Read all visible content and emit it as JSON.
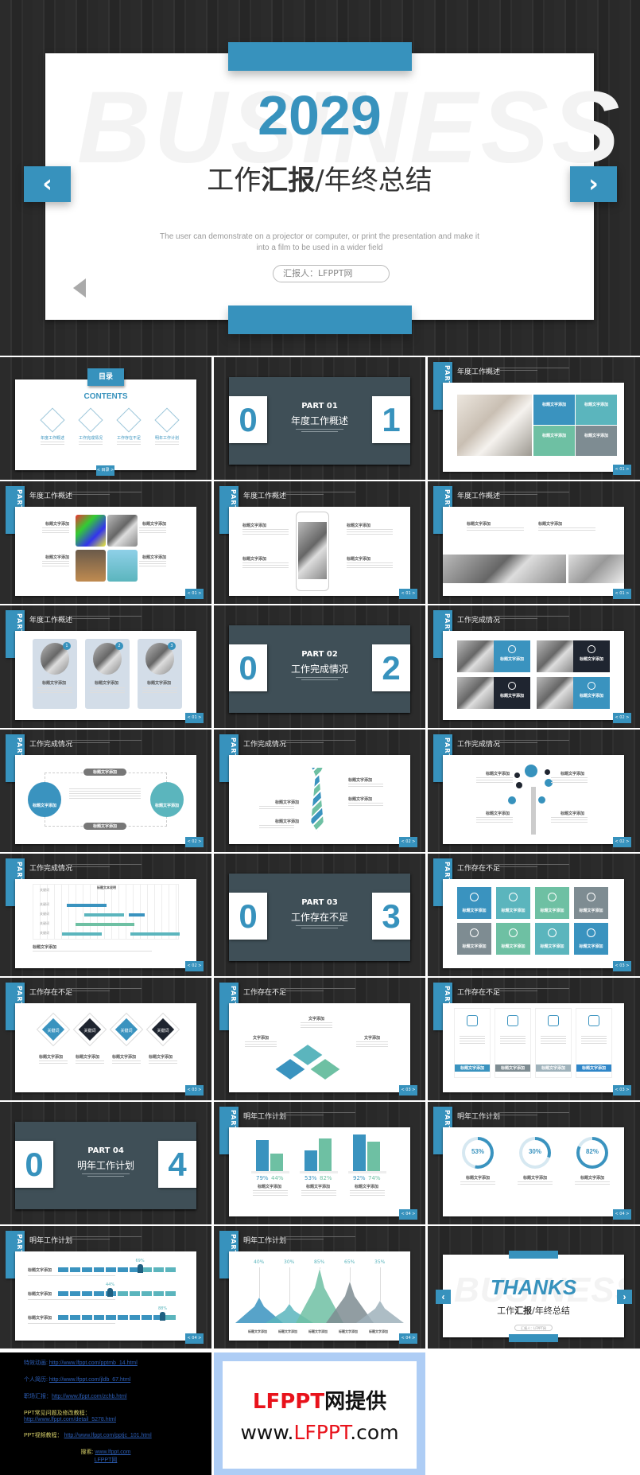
{
  "hero": {
    "watermark": "BUSINESS",
    "year": "2029",
    "title_parts": [
      "工作",
      "汇报",
      "/年终总结"
    ],
    "subtitle_line1": "The user can demonstrate on a projector or computer, or print the presentation and make it",
    "subtitle_line2": "into a film to be used in a wider field",
    "presenter": "汇报人：LFPPT网",
    "prev_icon": "‹",
    "next_icon": "›",
    "accent": "#3792bd"
  },
  "slides": [
    {
      "type": "contents",
      "tab": "目录",
      "heading": "CONTENTS",
      "items": [
        "年度工作概述",
        "工作完成情况",
        "工作存在不足",
        "明年工作计划"
      ],
      "page": "< 目录 >"
    },
    {
      "type": "section",
      "part": "PART 01",
      "title": "年度工作概述",
      "digit_left": "0",
      "digit_right": "1"
    },
    {
      "type": "tiles4",
      "part_word": "PART",
      "part_num": "ONE",
      "title": "年度工作概述",
      "labels": [
        "标题文字添加",
        "标题文字添加",
        "标题文字添加",
        "标题文字添加"
      ],
      "tile_colors": [
        "#3a93bf",
        "#5bb5bd",
        "#6ec0a3",
        "#7e8c92"
      ],
      "page": "< 01 >"
    },
    {
      "type": "imgs4",
      "part_word": "PART",
      "part_num": "ONE",
      "title": "年度工作概述",
      "labels": [
        "标题文字添加",
        "标题文字添加",
        "标题文字添加",
        "标题文字添加"
      ],
      "page": "< 01 >"
    },
    {
      "type": "phone",
      "part_word": "PART",
      "part_num": "ONE",
      "title": "年度工作概述",
      "labels": [
        "标题文字添加",
        "标题文字添加",
        "标题文字添加",
        "标题文字添加"
      ],
      "page": "< 01 >"
    },
    {
      "type": "photos2",
      "part_word": "PART",
      "part_num": "ONE",
      "title": "年度工作概述",
      "labels": [
        "标题文字添加",
        "标题文字添加"
      ],
      "page": "< 01 >"
    },
    {
      "type": "cards3",
      "part_word": "PART",
      "part_num": "ONE",
      "title": "年度工作概述",
      "numbers": [
        "1",
        "2",
        "3"
      ],
      "labels": [
        "标题文字添加",
        "标题文字添加",
        "标题文字添加"
      ],
      "page": "< 01 >"
    },
    {
      "type": "section",
      "part": "PART 02",
      "title": "工作完成情况",
      "digit_left": "0",
      "digit_right": "2"
    },
    {
      "type": "tiles4b",
      "part_word": "PART",
      "part_num": "TWO",
      "title": "工作完成情况",
      "labels": [
        "标题文字添加",
        "标题文字添加",
        "标题文字添加",
        "标题文字添加"
      ],
      "panel_colors": [
        "#3a93bf",
        "#1f2530",
        "#1f2530",
        "#3a93bf"
      ],
      "page": "< 02 >"
    },
    {
      "type": "circles",
      "part_word": "PART",
      "part_num": "TWO",
      "title": "工作完成情况",
      "circle_labels": [
        "标题文字添加",
        "标题文字添加"
      ],
      "pill_labels": [
        "标题文字添加",
        "标题文字添加"
      ],
      "page": "< 02 >"
    },
    {
      "type": "tie",
      "part_word": "PART",
      "part_num": "TWO",
      "title": "工作完成情况",
      "labels": [
        "标题文字添加",
        "标题文字添加",
        "标题文字添加",
        "标题文字添加"
      ],
      "page": "< 02 >"
    },
    {
      "type": "tree",
      "part_word": "PART",
      "part_num": "TWO",
      "title": "工作完成情况",
      "labels": [
        "标题文字添加",
        "标题文字添加",
        "标题文字添加",
        "标题文字添加"
      ],
      "page": "< 02 >"
    },
    {
      "type": "gantt",
      "part_word": "PART",
      "part_num": "TWO",
      "title": "工作完成情况",
      "header": "标题文本说明",
      "rows": [
        "关键词",
        "关键词",
        "关键词",
        "关键词",
        "关键词"
      ],
      "label": "标题文字添加",
      "page": "< 02 >"
    },
    {
      "type": "section",
      "part": "PART 03",
      "title": "工作存在不足",
      "digit_left": "0",
      "digit_right": "3"
    },
    {
      "type": "tiles8",
      "part_word": "PART",
      "part_num": "THREE",
      "title": "工作存在不足",
      "labels": [
        "标题文字添加",
        "标题文字添加",
        "标题文字添加",
        "标题文字添加",
        "标题文字添加",
        "标题文字添加",
        "标题文字添加",
        "标题文字添加"
      ],
      "tile_colors": [
        "#3a93bf",
        "#5bb5bd",
        "#6ec0a3",
        "#7e8c92",
        "#7e8c92",
        "#6ec0a3",
        "#5bb5bd",
        "#3a93bf"
      ],
      "page": "< 03 >"
    },
    {
      "type": "diamonds4",
      "part_word": "PART",
      "part_num": "THREE",
      "title": "工作存在不足",
      "keywords": [
        "关键词",
        "关键词",
        "关键词",
        "关键词"
      ],
      "labels": [
        "标题文字添加",
        "标题文字添加",
        "标题文字添加",
        "标题文字添加"
      ],
      "page": "< 03 >"
    },
    {
      "type": "diamonds3",
      "part_word": "PART",
      "part_num": "THREE",
      "title": "工作存在不足",
      "labels": [
        "文字添加",
        "文字添加",
        "文字添加"
      ],
      "page": "< 03 >"
    },
    {
      "type": "cards4btn",
      "part_word": "PART",
      "part_num": "THREE",
      "title": "工作存在不足",
      "labels": [
        "标题文字添加",
        "标题文字添加",
        "标题文字添加",
        "标题文字添加"
      ],
      "button_colors": [
        "#3a93bf",
        "#7e8c92",
        "#9fb2bb",
        "#2f86c8"
      ],
      "page": "< 03 >"
    },
    {
      "type": "section",
      "part": "PART 04",
      "title": "明年工作计划",
      "digit_left": "0",
      "digit_right": "4"
    },
    {
      "type": "bars",
      "part_word": "PART",
      "part_num": "FOUR",
      "title": "明年工作计划",
      "groups": [
        {
          "a": "79%",
          "b": "44%",
          "va": 79,
          "vb": 44
        },
        {
          "a": "53%",
          "b": "82%",
          "va": 53,
          "vb": 82
        },
        {
          "a": "92%",
          "b": "74%",
          "va": 92,
          "vb": 74
        }
      ],
      "labels": [
        "标题文字添加",
        "标题文字添加",
        "标题文字添加"
      ],
      "page": "< 04 >"
    },
    {
      "type": "rings",
      "part_word": "PART",
      "part_num": "FOUR",
      "title": "明年工作计划",
      "values": [
        "53%",
        "30%",
        "82%"
      ],
      "levels": [
        53,
        30,
        82
      ],
      "labels": [
        "标题文字添加",
        "标题文字添加",
        "标题文字添加"
      ],
      "page": "< 04 >"
    },
    {
      "type": "progress",
      "part_word": "PART",
      "part_num": "FOUR",
      "title": "明年工作计划",
      "values": [
        "69%",
        "44%",
        "88%"
      ],
      "levels": [
        69,
        44,
        88
      ],
      "labels": [
        "标题文字添加",
        "标题文字添加",
        "标题文字添加"
      ],
      "page": "< 04 >"
    },
    {
      "type": "mountains",
      "part_word": "PART",
      "part_num": "FOUR",
      "title": "明年工作计划",
      "values": [
        "40%",
        "30%",
        "85%",
        "65%",
        "35%"
      ],
      "levels": [
        40,
        30,
        85,
        65,
        35
      ],
      "colors": [
        "#3a93bf",
        "#5bb5bd",
        "#6ec0a3",
        "#7e8c92",
        "#9fb2bb"
      ],
      "labels": [
        "标题文字添加",
        "标题文字添加",
        "标题文字添加",
        "标题文字添加",
        "标题文字添加"
      ],
      "page": "< 04 >"
    },
    {
      "type": "thanks",
      "watermark": "BUSINESS",
      "heading": "THANKS",
      "title_parts": [
        "工作",
        "汇报",
        "/年终总结"
      ],
      "presenter": "汇报人：LFPPT网"
    }
  ],
  "links": [
    {
      "label": "特效动画",
      "sep": ": ",
      "url": "http://www.lfppt.com/pptmb_14.html",
      "color": "blue"
    },
    {
      "label": "个人简历",
      "sep": ": ",
      "url": "http://www.lfppt.com/jldb_67.html",
      "color": "blue"
    },
    {
      "label": "职场汇报",
      "sep": "：",
      "url": "http://www.lfppt.com/zchb.html",
      "color": "blue"
    },
    {
      "label": "PPT常见问题及修改教程：",
      "sep": "",
      "url": "http://www.lfppt.com/detail_5278.html",
      "color": "yel",
      "newline": true
    },
    {
      "label": "PPT视频教程：",
      "sep": " ",
      "url": "http://www.lfppt.com/pptjc_101.html",
      "color": "yel"
    }
  ],
  "search": {
    "label": "搜索: ",
    "url": "www.lfppt.com",
    "name": "LFPPT网"
  },
  "promo": {
    "line1_red": "LFPPT",
    "line1_black": "网提供",
    "line2_pre": "www.",
    "line2_red": "LFPPT",
    "line2_post": ".com"
  }
}
